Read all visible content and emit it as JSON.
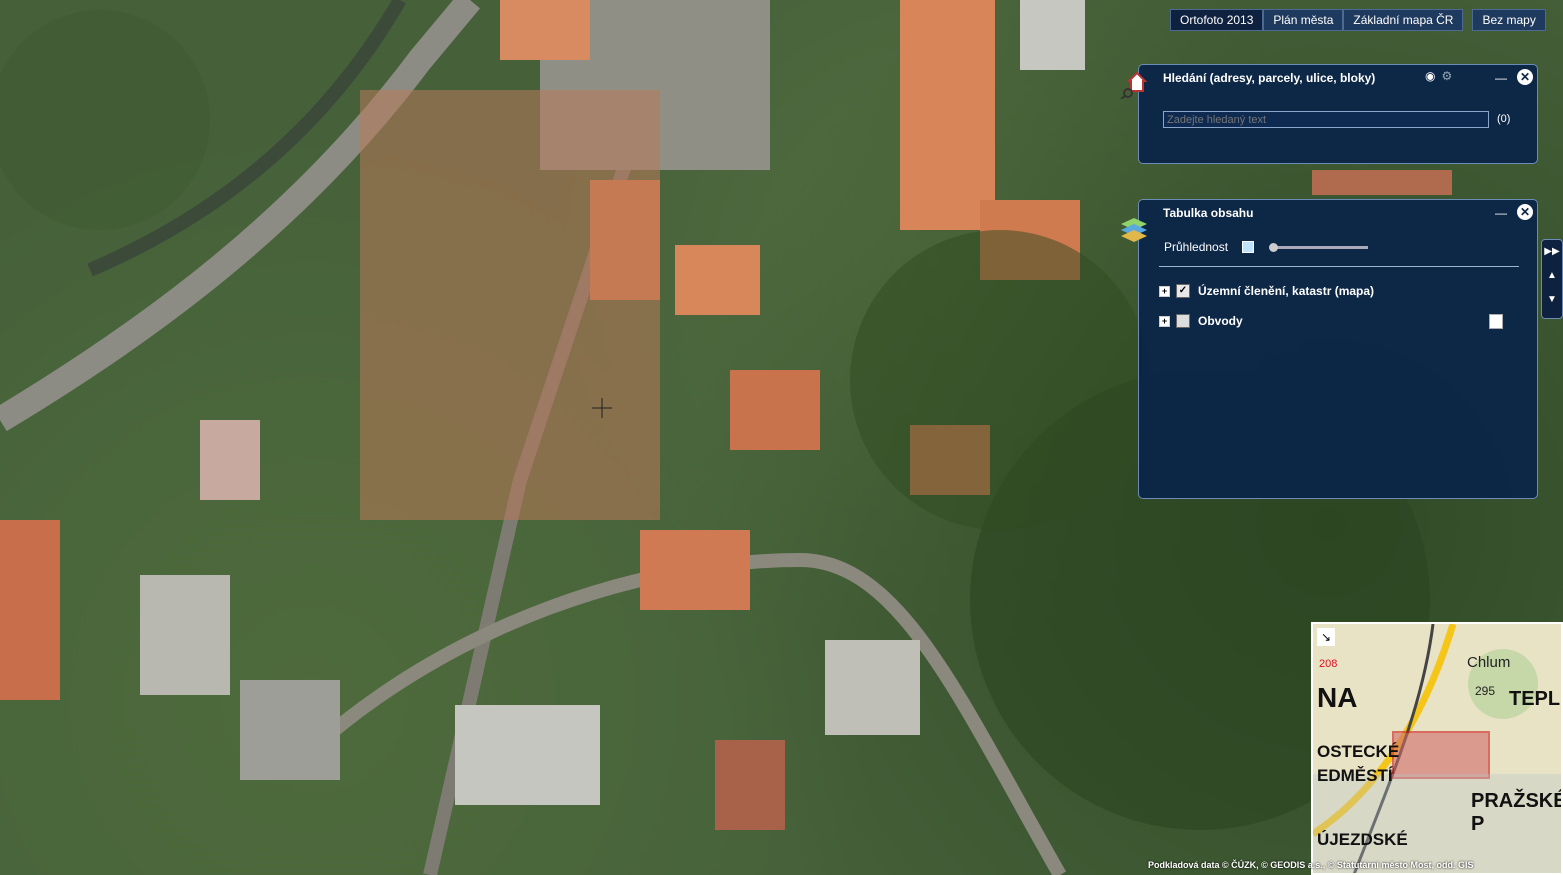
{
  "basemaps": {
    "items": [
      "Ortofoto 2013",
      "Plán města",
      "Základní mapa ČR"
    ],
    "active_index": 0,
    "none_label": "Bez mapy"
  },
  "search_panel": {
    "title": "Hledání (adresy, parcely, ulice, bloky)",
    "placeholder": "Zadejte hledaný text",
    "result_count": "(0)"
  },
  "toc_panel": {
    "title": "Tabulka obsahu",
    "transparency_label": "Průhlednost",
    "transparency_value": 0,
    "layers": [
      {
        "label": "Územní členění, katastr (mapa)",
        "checked": true
      },
      {
        "label": "Obvody",
        "checked": false
      }
    ]
  },
  "overview_map": {
    "labels": [
      "208",
      "NA",
      "Chlum",
      "295",
      "TEPLIC",
      "OSTECKÉ",
      "EDMĚSTÍ",
      "PRAŽSKÉ P",
      "ÚJEZDSKÉ"
    ]
  },
  "attribution": "Podkladová data © ČÚZK, © GEODIS a.s., © Statutární město Most, odd. GIS"
}
